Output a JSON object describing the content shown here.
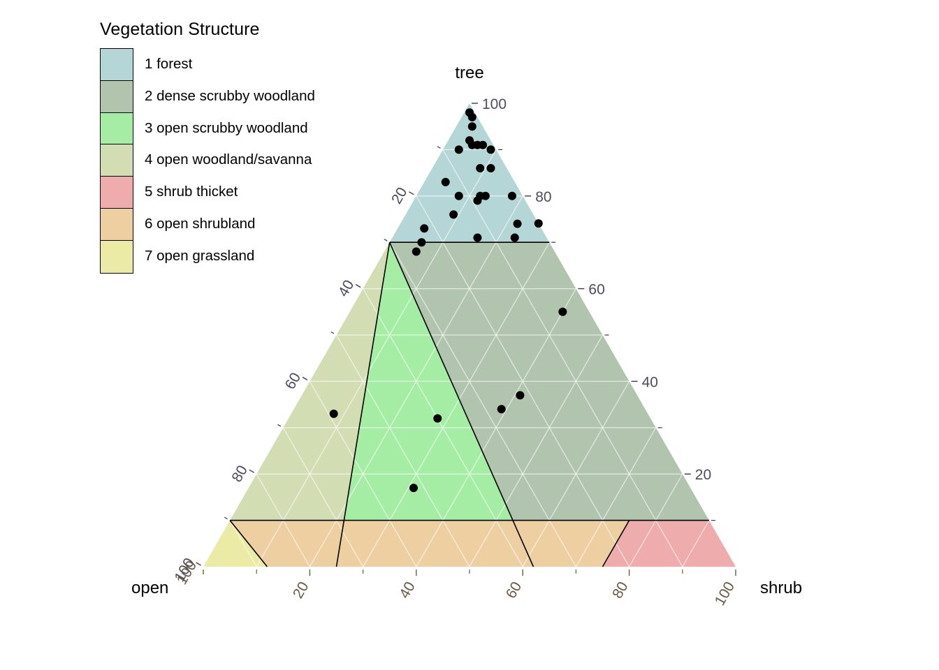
{
  "legend": {
    "title": "Vegetation Structure",
    "items": [
      {
        "label": "1 forest",
        "color": "#b5d6d6"
      },
      {
        "label": "2 dense scrubby woodland",
        "color": "#b1c4ae"
      },
      {
        "label": "3 open scrubby woodland",
        "color": "#a5eda5"
      },
      {
        "label": "4 open woodland/savanna",
        "color": "#d3ddb4"
      },
      {
        "label": "5 shrub thicket",
        "color": "#eeacac"
      },
      {
        "label": "6 open shrubland",
        "color": "#edcfa2"
      },
      {
        "label": "7 open grassland",
        "color": "#ebeba5"
      }
    ]
  },
  "chart_data": {
    "type": "scatter",
    "subtype": "ternary",
    "title": "Vegetation Structure",
    "axes": {
      "top": {
        "name": "tree",
        "label": "tree",
        "ticks": [
          20,
          40,
          60,
          80,
          100
        ],
        "range": [
          0,
          100
        ]
      },
      "left": {
        "name": "open",
        "label": "open",
        "ticks": [
          20,
          40,
          60,
          80,
          100
        ],
        "range": [
          0,
          100
        ]
      },
      "right": {
        "name": "shrub",
        "label": "shrub",
        "ticks": [
          20,
          40,
          60,
          80,
          100
        ],
        "range": [
          0,
          100
        ]
      }
    },
    "tick_labels": {
      "right_axis": [
        "100",
        "80",
        "60",
        "40",
        "20"
      ],
      "left_axis": [
        "20",
        "40",
        "60",
        "80",
        "100"
      ],
      "bottom_axis": [
        "20",
        "40",
        "60",
        "80",
        "100"
      ]
    },
    "grid": true,
    "grid_interval": 10,
    "legend_position": "top-left",
    "regions": [
      {
        "id": 1,
        "label": "1 forest",
        "color": "#b5d6d6",
        "rule": "tree >= 70"
      },
      {
        "id": 2,
        "label": "2 dense scrubby woodland",
        "color": "#b1c4ae",
        "rule": "tree < 70, shrub > open, shrub <= 70"
      },
      {
        "id": 3,
        "label": "3 open scrubby woodland",
        "color": "#a5eda5",
        "rule": "tree < 70, tree >= 10, mixed"
      },
      {
        "id": 4,
        "label": "4 open woodland/savanna",
        "color": "#d3ddb4",
        "rule": "tree < 70, open > shrub"
      },
      {
        "id": 5,
        "label": "5 shrub thicket",
        "color": "#eeacac",
        "rule": "shrub > 70, tree < 10"
      },
      {
        "id": 6,
        "label": "6 open shrubland",
        "color": "#edcfa2",
        "rule": "tree < 10, mixed open/shrub"
      },
      {
        "id": 7,
        "label": "7 open grassland",
        "color": "#ebeba5",
        "rule": "tree < 10, open > 85"
      }
    ],
    "point_style": {
      "marker": "circle",
      "color": "#000000",
      "size": 6
    },
    "points": [
      {
        "tree": 98,
        "shrub": 1,
        "open": 1
      },
      {
        "tree": 97,
        "shrub": 2,
        "open": 1
      },
      {
        "tree": 95,
        "shrub": 3,
        "open": 2
      },
      {
        "tree": 92,
        "shrub": 4,
        "open": 4
      },
      {
        "tree": 91,
        "shrub": 5,
        "open": 4
      },
      {
        "tree": 91,
        "shrub": 6,
        "open": 3
      },
      {
        "tree": 91,
        "shrub": 7,
        "open": 2
      },
      {
        "tree": 90,
        "shrub": 9,
        "open": 1
      },
      {
        "tree": 90,
        "shrub": 3,
        "open": 7
      },
      {
        "tree": 86,
        "shrub": 9,
        "open": 5
      },
      {
        "tree": 86,
        "shrub": 11,
        "open": 3
      },
      {
        "tree": 83,
        "shrub": 4,
        "open": 13
      },
      {
        "tree": 80,
        "shrub": 8,
        "open": 12
      },
      {
        "tree": 80,
        "shrub": 12,
        "open": 8
      },
      {
        "tree": 80,
        "shrub": 13,
        "open": 7
      },
      {
        "tree": 79,
        "shrub": 12,
        "open": 9
      },
      {
        "tree": 80,
        "shrub": 18,
        "open": 2
      },
      {
        "tree": 80,
        "shrub": 28,
        "open": 0
      },
      {
        "tree": 76,
        "shrub": 9,
        "open": 15
      },
      {
        "tree": 74,
        "shrub": 22,
        "open": 4
      },
      {
        "tree": 73,
        "shrub": 5,
        "open": 22
      },
      {
        "tree": 71,
        "shrub": 16,
        "open": 13
      },
      {
        "tree": 71,
        "shrub": 23,
        "open": 6
      },
      {
        "tree": 70,
        "shrub": 6,
        "open": 24
      },
      {
        "tree": 68,
        "shrub": 6,
        "open": 26
      },
      {
        "tree": 55,
        "shrub": 40,
        "open": 5
      },
      {
        "tree": 37,
        "shrub": 41,
        "open": 22
      },
      {
        "tree": 34,
        "shrub": 39,
        "open": 27
      },
      {
        "tree": 33,
        "shrub": 8,
        "open": 59
      },
      {
        "tree": 32,
        "shrub": 28,
        "open": 40
      },
      {
        "tree": 17,
        "shrub": 31,
        "open": 52
      }
    ]
  }
}
